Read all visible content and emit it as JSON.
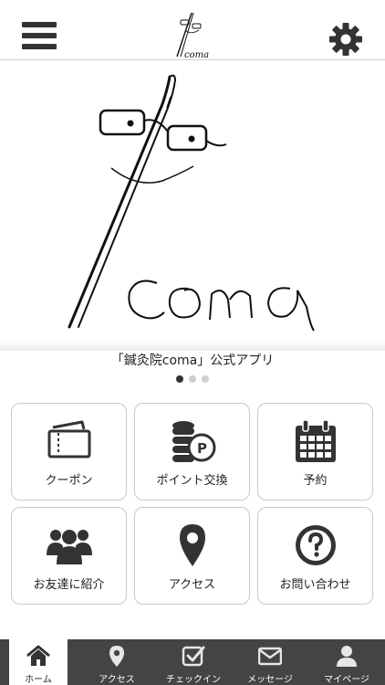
{
  "app": {
    "caption": "「鍼灸院coma」公式アプリ",
    "logo_text": "coma",
    "accent_color": "#333333",
    "tabbar_color": "#444444"
  },
  "header": {
    "menu_icon": "hamburger-menu-icon",
    "settings_icon": "gear-icon"
  },
  "carousel": {
    "page_count": 3,
    "active_page": 1
  },
  "tiles": [
    {
      "label": "クーポン",
      "icon": "ticket-icon"
    },
    {
      "label": "ポイント交換",
      "icon": "coins-point-icon"
    },
    {
      "label": "予約",
      "icon": "calendar-icon"
    },
    {
      "label": "お友達に紹介",
      "icon": "group-people-icon"
    },
    {
      "label": "アクセス",
      "icon": "map-pin-icon"
    },
    {
      "label": "お問い合わせ",
      "icon": "question-circle-icon"
    }
  ],
  "tabbar": {
    "items": [
      {
        "label": "ホーム",
        "icon": "home-icon",
        "active": true
      },
      {
        "label": "アクセス",
        "icon": "map-pin-icon",
        "active": false
      },
      {
        "label": "チェックイン",
        "icon": "checkbox-icon",
        "active": false
      },
      {
        "label": "メッセージ",
        "icon": "envelope-icon",
        "active": false
      },
      {
        "label": "マイページ",
        "icon": "person-icon",
        "active": false
      }
    ]
  }
}
